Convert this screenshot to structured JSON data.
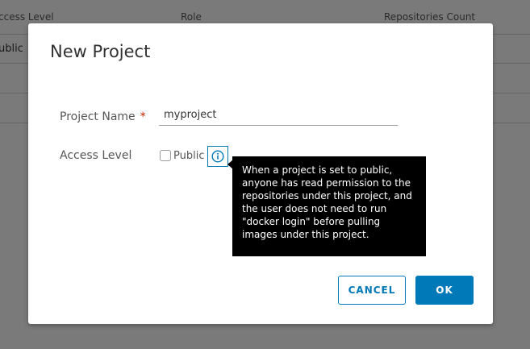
{
  "background": {
    "headers": [
      "ccess Level",
      "Role",
      "Repositories Count"
    ],
    "rows": [
      "ublic",
      "",
      ""
    ]
  },
  "modal": {
    "title": "New Project",
    "fields": {
      "project_name_label": "Project Name",
      "required_mark": "*",
      "project_name_value": "myproject",
      "access_level_label": "Access Level",
      "public_label": "Public"
    },
    "tooltip": "When a project is set to public, anyone has read permission to the repositories under this project, and the user does not need to run \"docker login\" before pulling images under this project.",
    "buttons": {
      "cancel": "CANCEL",
      "ok": "OK"
    }
  },
  "colors": {
    "accent": "#0079b8",
    "required": "#c92100",
    "tooltip_bg": "#000000"
  },
  "icons": {
    "info": "info-circle-icon"
  }
}
